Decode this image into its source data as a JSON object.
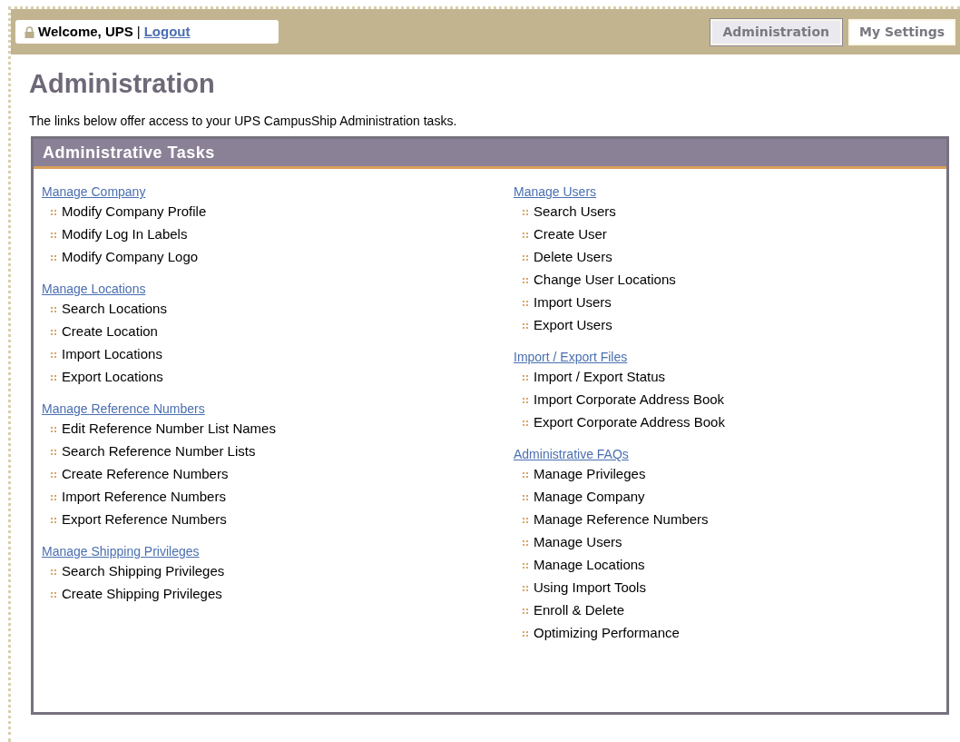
{
  "header": {
    "welcome": "Welcome, UPS",
    "separator": "|",
    "logout": "Logout"
  },
  "tabs": [
    {
      "label": "Administration",
      "selected": true
    },
    {
      "label": "My Settings",
      "selected": false
    }
  ],
  "page_title": "Administration",
  "intro": "The links below offer access to your UPS CampusShip Administration tasks.",
  "panel": {
    "title": "Administrative Tasks",
    "columns": [
      [
        {
          "title": "Manage Company",
          "items": [
            "Modify Company Profile",
            "Modify Log In Labels",
            "Modify Company Logo"
          ]
        },
        {
          "title": "Manage Locations",
          "items": [
            "Search Locations",
            "Create Location",
            "Import Locations",
            "Export Locations"
          ]
        },
        {
          "title": "Manage Reference Numbers",
          "items": [
            "Edit Reference Number List Names",
            "Search Reference Number Lists",
            "Create Reference Numbers",
            "Import Reference Numbers",
            "Export Reference Numbers"
          ]
        },
        {
          "title": "Manage Shipping Privileges",
          "items": [
            "Search Shipping Privileges",
            "Create Shipping Privileges"
          ]
        }
      ],
      [
        {
          "title": "Manage Users",
          "items": [
            "Search Users",
            "Create User",
            "Delete Users",
            "Change User Locations",
            "Import Users",
            "Export Users"
          ]
        },
        {
          "title": "Import / Export Files",
          "items": [
            "Import / Export Status",
            "Import Corporate Address Book",
            "Export Corporate Address Book"
          ]
        },
        {
          "title": "Administrative FAQs",
          "items": [
            "Manage Privileges",
            "Manage Company",
            "Manage Reference Numbers",
            "Manage Users",
            "Manage Locations",
            "Using Import Tools",
            "Enroll & Delete",
            "Optimizing Performance"
          ]
        }
      ]
    ]
  }
}
